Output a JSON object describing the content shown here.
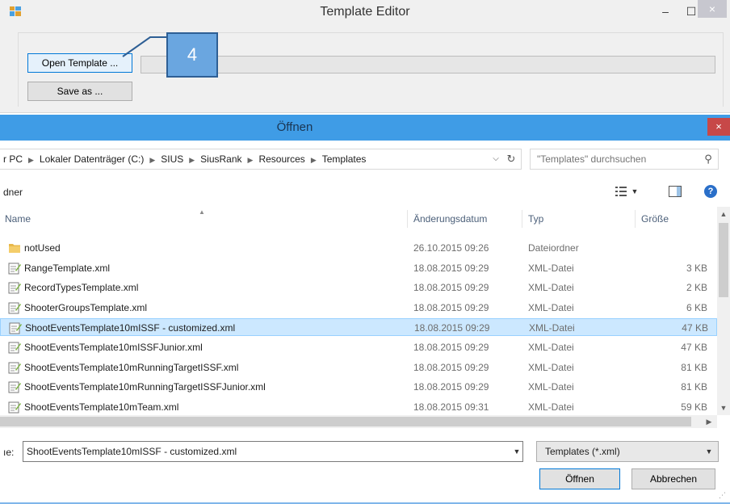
{
  "editor": {
    "title": "Template Editor",
    "buttons": {
      "minimize": "–",
      "maximize": "☐",
      "close": "×"
    },
    "open_template_label": "Open Template ...",
    "save_as_label": "Save as ...",
    "callout_number": "4"
  },
  "dialog": {
    "title": "Öffnen",
    "close_glyph": "×",
    "breadcrumb": [
      "r PC",
      "Lokaler Datenträger (C:)",
      "SIUS",
      "SiusRank",
      "Resources",
      "Templates"
    ],
    "search_placeholder": "\"Templates\" durchsuchen",
    "folder_label": "dner",
    "columns": {
      "name": "Name",
      "date": "Änderungsdatum",
      "type": "Typ",
      "size": "Größe"
    },
    "files": [
      {
        "name": "notUsed",
        "date": "26.10.2015 09:26",
        "type": "Dateiordner",
        "size": "",
        "icon": "folder-icon"
      },
      {
        "name": "RangeTemplate.xml",
        "date": "18.08.2015 09:29",
        "type": "XML-Datei",
        "size": "3 KB",
        "icon": "xml-file-icon"
      },
      {
        "name": "RecordTypesTemplate.xml",
        "date": "18.08.2015 09:29",
        "type": "XML-Datei",
        "size": "2 KB",
        "icon": "xml-file-icon"
      },
      {
        "name": "ShooterGroupsTemplate.xml",
        "date": "18.08.2015 09:29",
        "type": "XML-Datei",
        "size": "6 KB",
        "icon": "xml-file-icon"
      },
      {
        "name": "ShootEventsTemplate10mISSF - customized.xml",
        "date": "18.08.2015 09:29",
        "type": "XML-Datei",
        "size": "47 KB",
        "icon": "xml-file-icon",
        "selected": true
      },
      {
        "name": "ShootEventsTemplate10mISSFJunior.xml",
        "date": "18.08.2015 09:29",
        "type": "XML-Datei",
        "size": "47 KB",
        "icon": "xml-file-icon"
      },
      {
        "name": "ShootEventsTemplate10mRunningTargetISSF.xml",
        "date": "18.08.2015 09:29",
        "type": "XML-Datei",
        "size": "81 KB",
        "icon": "xml-file-icon"
      },
      {
        "name": "ShootEventsTemplate10mRunningTargetISSFJunior.xml",
        "date": "18.08.2015 09:29",
        "type": "XML-Datei",
        "size": "81 KB",
        "icon": "xml-file-icon"
      },
      {
        "name": "ShootEventsTemplate10mTeam.xml",
        "date": "18.08.2015 09:31",
        "type": "XML-Datei",
        "size": "59 KB",
        "icon": "xml-file-icon"
      }
    ],
    "filename_label": "ıe:",
    "filename_value": "ShootEventsTemplate10mISSF - customized.xml",
    "filetype_value": "Templates (*.xml)",
    "open_label": "Öffnen",
    "cancel_label": "Abbrechen"
  }
}
